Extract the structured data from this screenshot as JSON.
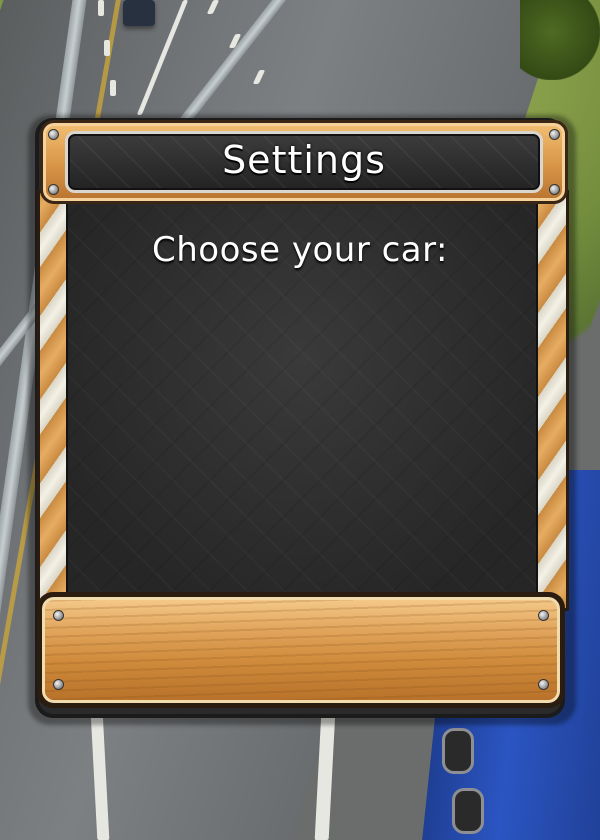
{
  "dialog": {
    "title": "Settings",
    "prompt": "Choose your car:"
  },
  "colors": {
    "wood_light": "#f2bf72",
    "wood_dark": "#b8732f",
    "panel": "#262626",
    "text": "#ffffff",
    "truck_blue": "#2b55c2"
  }
}
